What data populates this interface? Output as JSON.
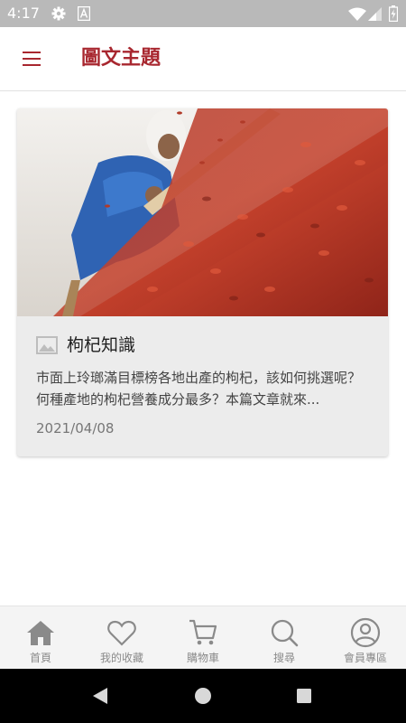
{
  "status_bar": {
    "time": "4:17",
    "icons": [
      "settings-icon",
      "a-notification-icon",
      "wifi-icon",
      "signal-icon",
      "battery-icon"
    ]
  },
  "app_bar": {
    "title": "圖文主題",
    "menu_icon": "hamburger-menu-icon",
    "accent_color": "#a8272f"
  },
  "article": {
    "title": "枸杞知識",
    "excerpt": "市面上玲瑯滿目標榜各地出產的枸杞，該如何挑選呢？何種產地的枸杞營養成分最多？本篇文章就來...",
    "date": "2021/04/08",
    "title_icon": "image-icon",
    "image_alt": "worker raking red goji berries drying in the sun"
  },
  "bottom_nav": {
    "items": [
      {
        "label": "首頁",
        "icon": "home-icon"
      },
      {
        "label": "我的收藏",
        "icon": "heart-icon"
      },
      {
        "label": "購物車",
        "icon": "cart-icon"
      },
      {
        "label": "搜尋",
        "icon": "search-icon"
      },
      {
        "label": "會員專區",
        "icon": "account-icon"
      }
    ],
    "color": "#8a8a8a"
  },
  "system_nav": {
    "buttons": [
      "back-icon",
      "home-circle-icon",
      "recents-icon"
    ]
  }
}
